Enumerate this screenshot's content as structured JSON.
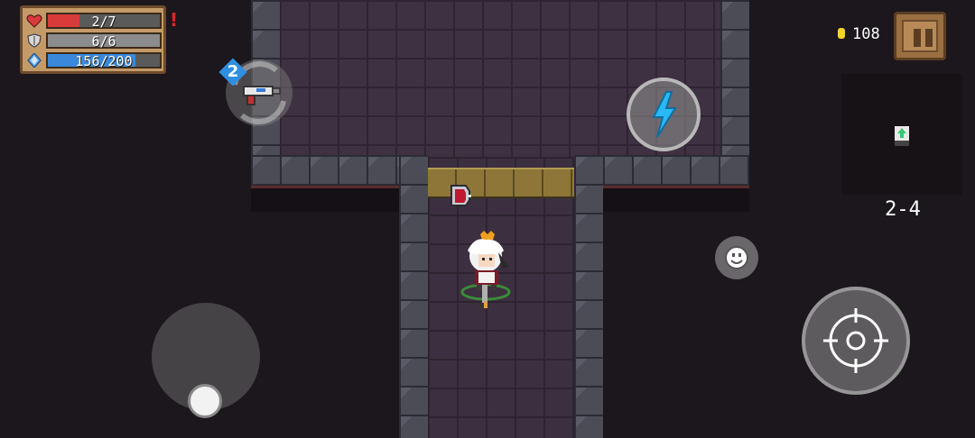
{
  "hud": {
    "health": {
      "current": 2,
      "max": 7,
      "text": "2/7",
      "fill_fraction": 0.286,
      "color": "#d93a3a"
    },
    "armor": {
      "current": 6,
      "max": 6,
      "text": "6/6",
      "fill_fraction": 1.0,
      "color": "#8c8c8c"
    },
    "energy": {
      "current": 156,
      "max": 200,
      "text": "156/200",
      "fill_fraction": 0.78,
      "color": "#3a88d9"
    },
    "alert": "!",
    "icons": [
      "heart-icon",
      "shield-icon",
      "energy-crystal-icon"
    ]
  },
  "weapon": {
    "swap_count": "2",
    "icon": "pistol-icon"
  },
  "currency": {
    "coins": "108",
    "icon": "coin-icon",
    "color": "#f4d430"
  },
  "pause": {
    "icon": "pause-icon"
  },
  "minimap": {
    "player_color": "#2ecc71"
  },
  "level": {
    "label": "2-4"
  },
  "controls": {
    "skill_icon": "lightning-icon",
    "skill_color": "#29b8f5",
    "emote_icon": "smiley-icon",
    "attack_icon": "crosshair-icon",
    "joystick_icon": "joystick-knob"
  },
  "world": {
    "pickups": [
      "health-potion"
    ],
    "characters": [
      "player-character"
    ]
  }
}
